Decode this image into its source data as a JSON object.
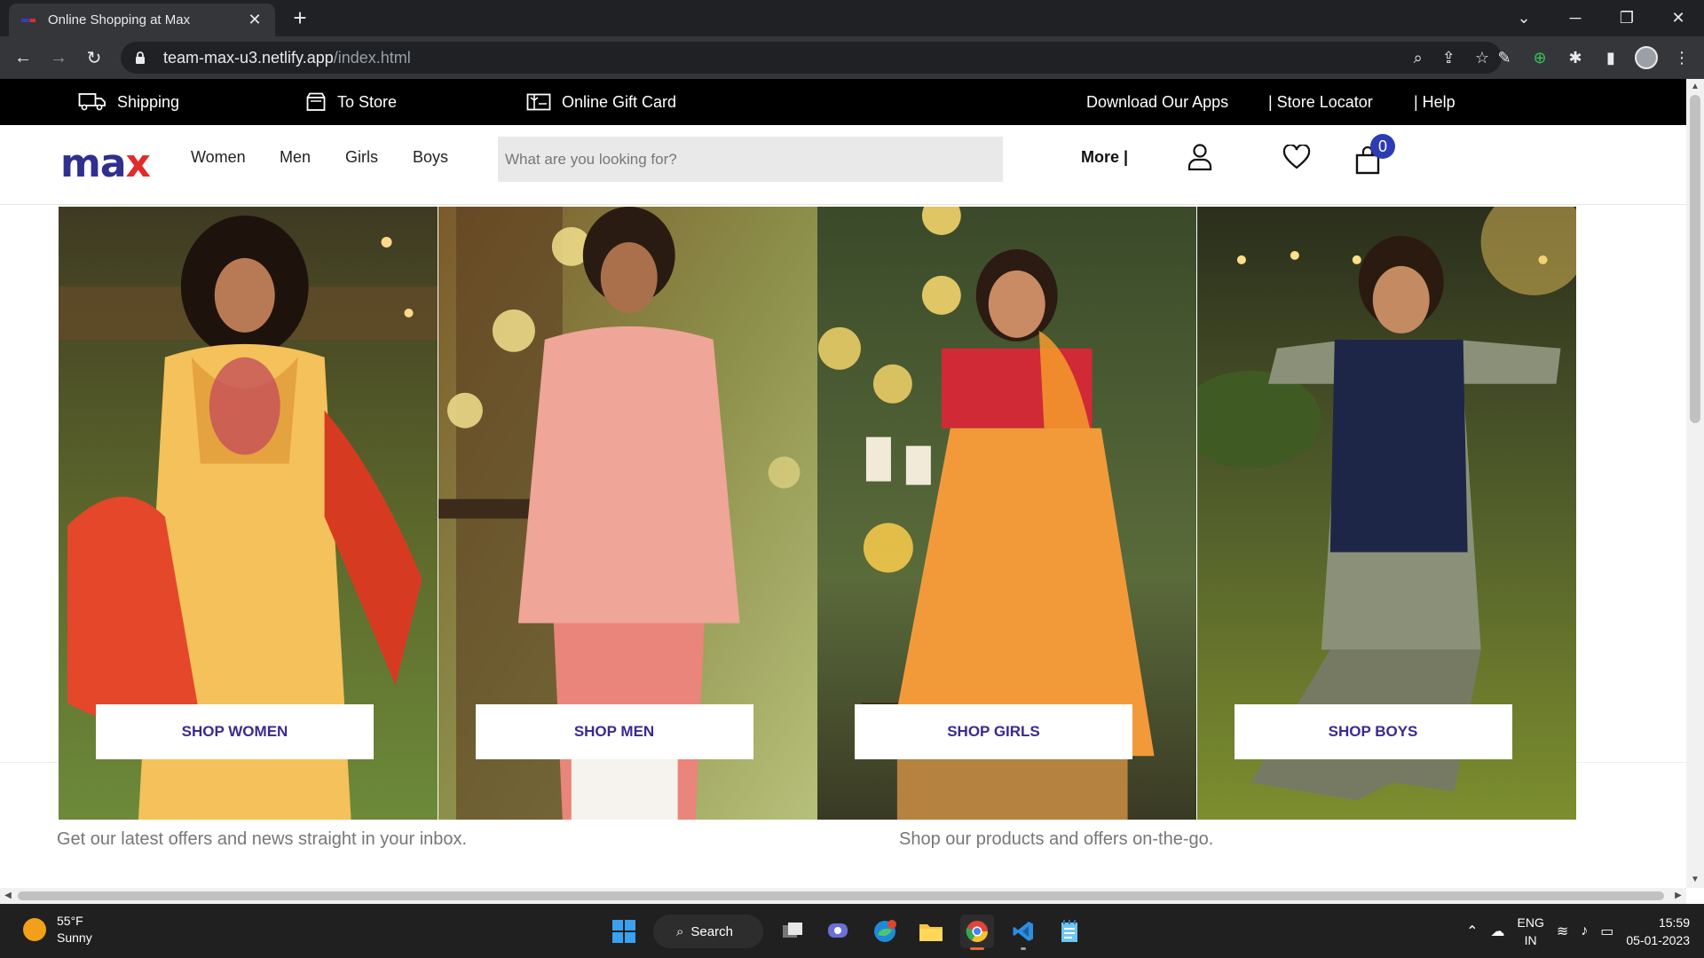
{
  "browser": {
    "tab_title": "Online Shopping at Max",
    "tab_close": "✕",
    "new_tab": "+",
    "url_host": "team-max-u3.netlify.app",
    "url_path": "/index.html",
    "win_min": "─",
    "win_max": "❐",
    "win_close": "✕",
    "tab_list": "⌄"
  },
  "topstrip": {
    "shipping": "Shipping",
    "to_store": "To Store",
    "gift_card": "Online Gift Card",
    "apps": "Download Our Apps",
    "store_locator": "| Store Locator",
    "help": "| Help"
  },
  "header": {
    "logo_main": "ma",
    "logo_x": "x",
    "nav": [
      "Women",
      "Men",
      "Girls",
      "Boys"
    ],
    "search_placeholder": "What are you looking for?",
    "more": "More |",
    "cart_count": "0"
  },
  "banner": {
    "panels": [
      {
        "cta": "SHOP WOMEN"
      },
      {
        "cta": "SHOP MEN"
      },
      {
        "cta": "SHOP GIRLS"
      },
      {
        "cta": "SHOP BOYS"
      }
    ]
  },
  "footer": {
    "newsletter": "Get our latest offers and news straight in your inbox.",
    "apps": "Shop our products and offers on-the-go."
  },
  "taskbar": {
    "temp": "55°F",
    "condition": "Sunny",
    "search_label": "Search",
    "lang": "ENG",
    "region": "IN",
    "time": "15:59",
    "date": "05-01-2023"
  },
  "colors": {
    "brand_blue": "#2f2f8f",
    "brand_red": "#e22a2a",
    "cta_text": "#3a2a8e",
    "cart_badge": "#2d3bb5"
  }
}
